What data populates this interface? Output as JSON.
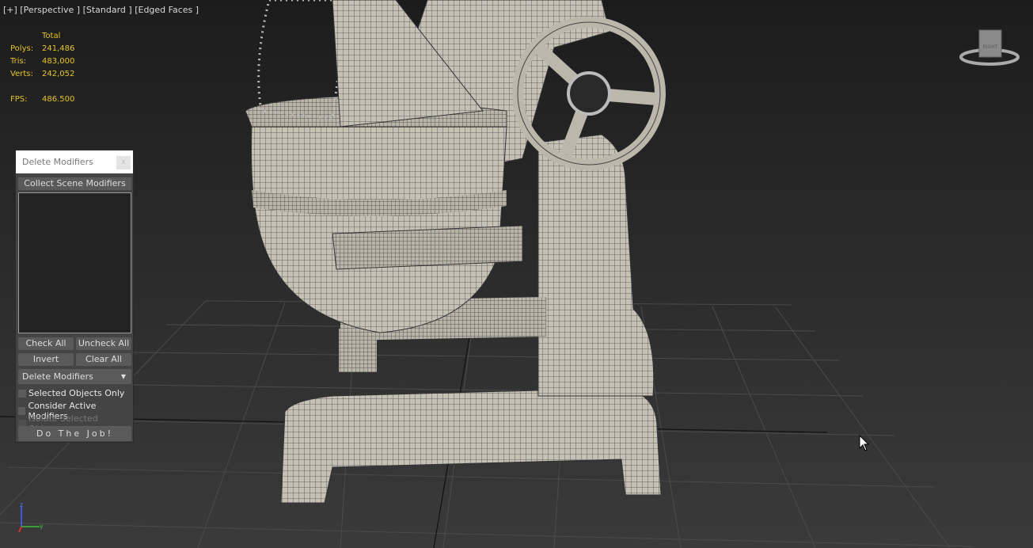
{
  "viewport": {
    "label": "[+] [Perspective ] [Standard ] [Edged Faces ]",
    "stats": {
      "header": "Total",
      "rows": [
        {
          "label": "Polys:",
          "value": "241,486"
        },
        {
          "label": "Tris:",
          "value": "483,000"
        },
        {
          "label": "Verts:",
          "value": "242,052"
        }
      ],
      "fps_label": "FPS:",
      "fps_value": "486.500"
    },
    "viewcube_face": "RIGHT",
    "colors": {
      "stats": "#e6c619",
      "mesh": "#c9c4b8",
      "wire": "#3a3a3a"
    }
  },
  "dialog": {
    "title": "Delete Modifiers",
    "close": "x",
    "collect": "Collect Scene Modifiers",
    "check_all": "Check All",
    "uncheck_all": "Uncheck All",
    "invert": "Invert",
    "clear_all": "Clear All",
    "mode": "Delete Modifiers",
    "options": [
      {
        "label": "Selected Objects Only",
        "checked": false,
        "enabled": true
      },
      {
        "label": "Consider Active Modifiers",
        "checked": false,
        "enabled": true
      },
      {
        "label": "Isolate Selected Objects",
        "checked": false,
        "enabled": false
      }
    ],
    "run": "Do The Job!"
  }
}
